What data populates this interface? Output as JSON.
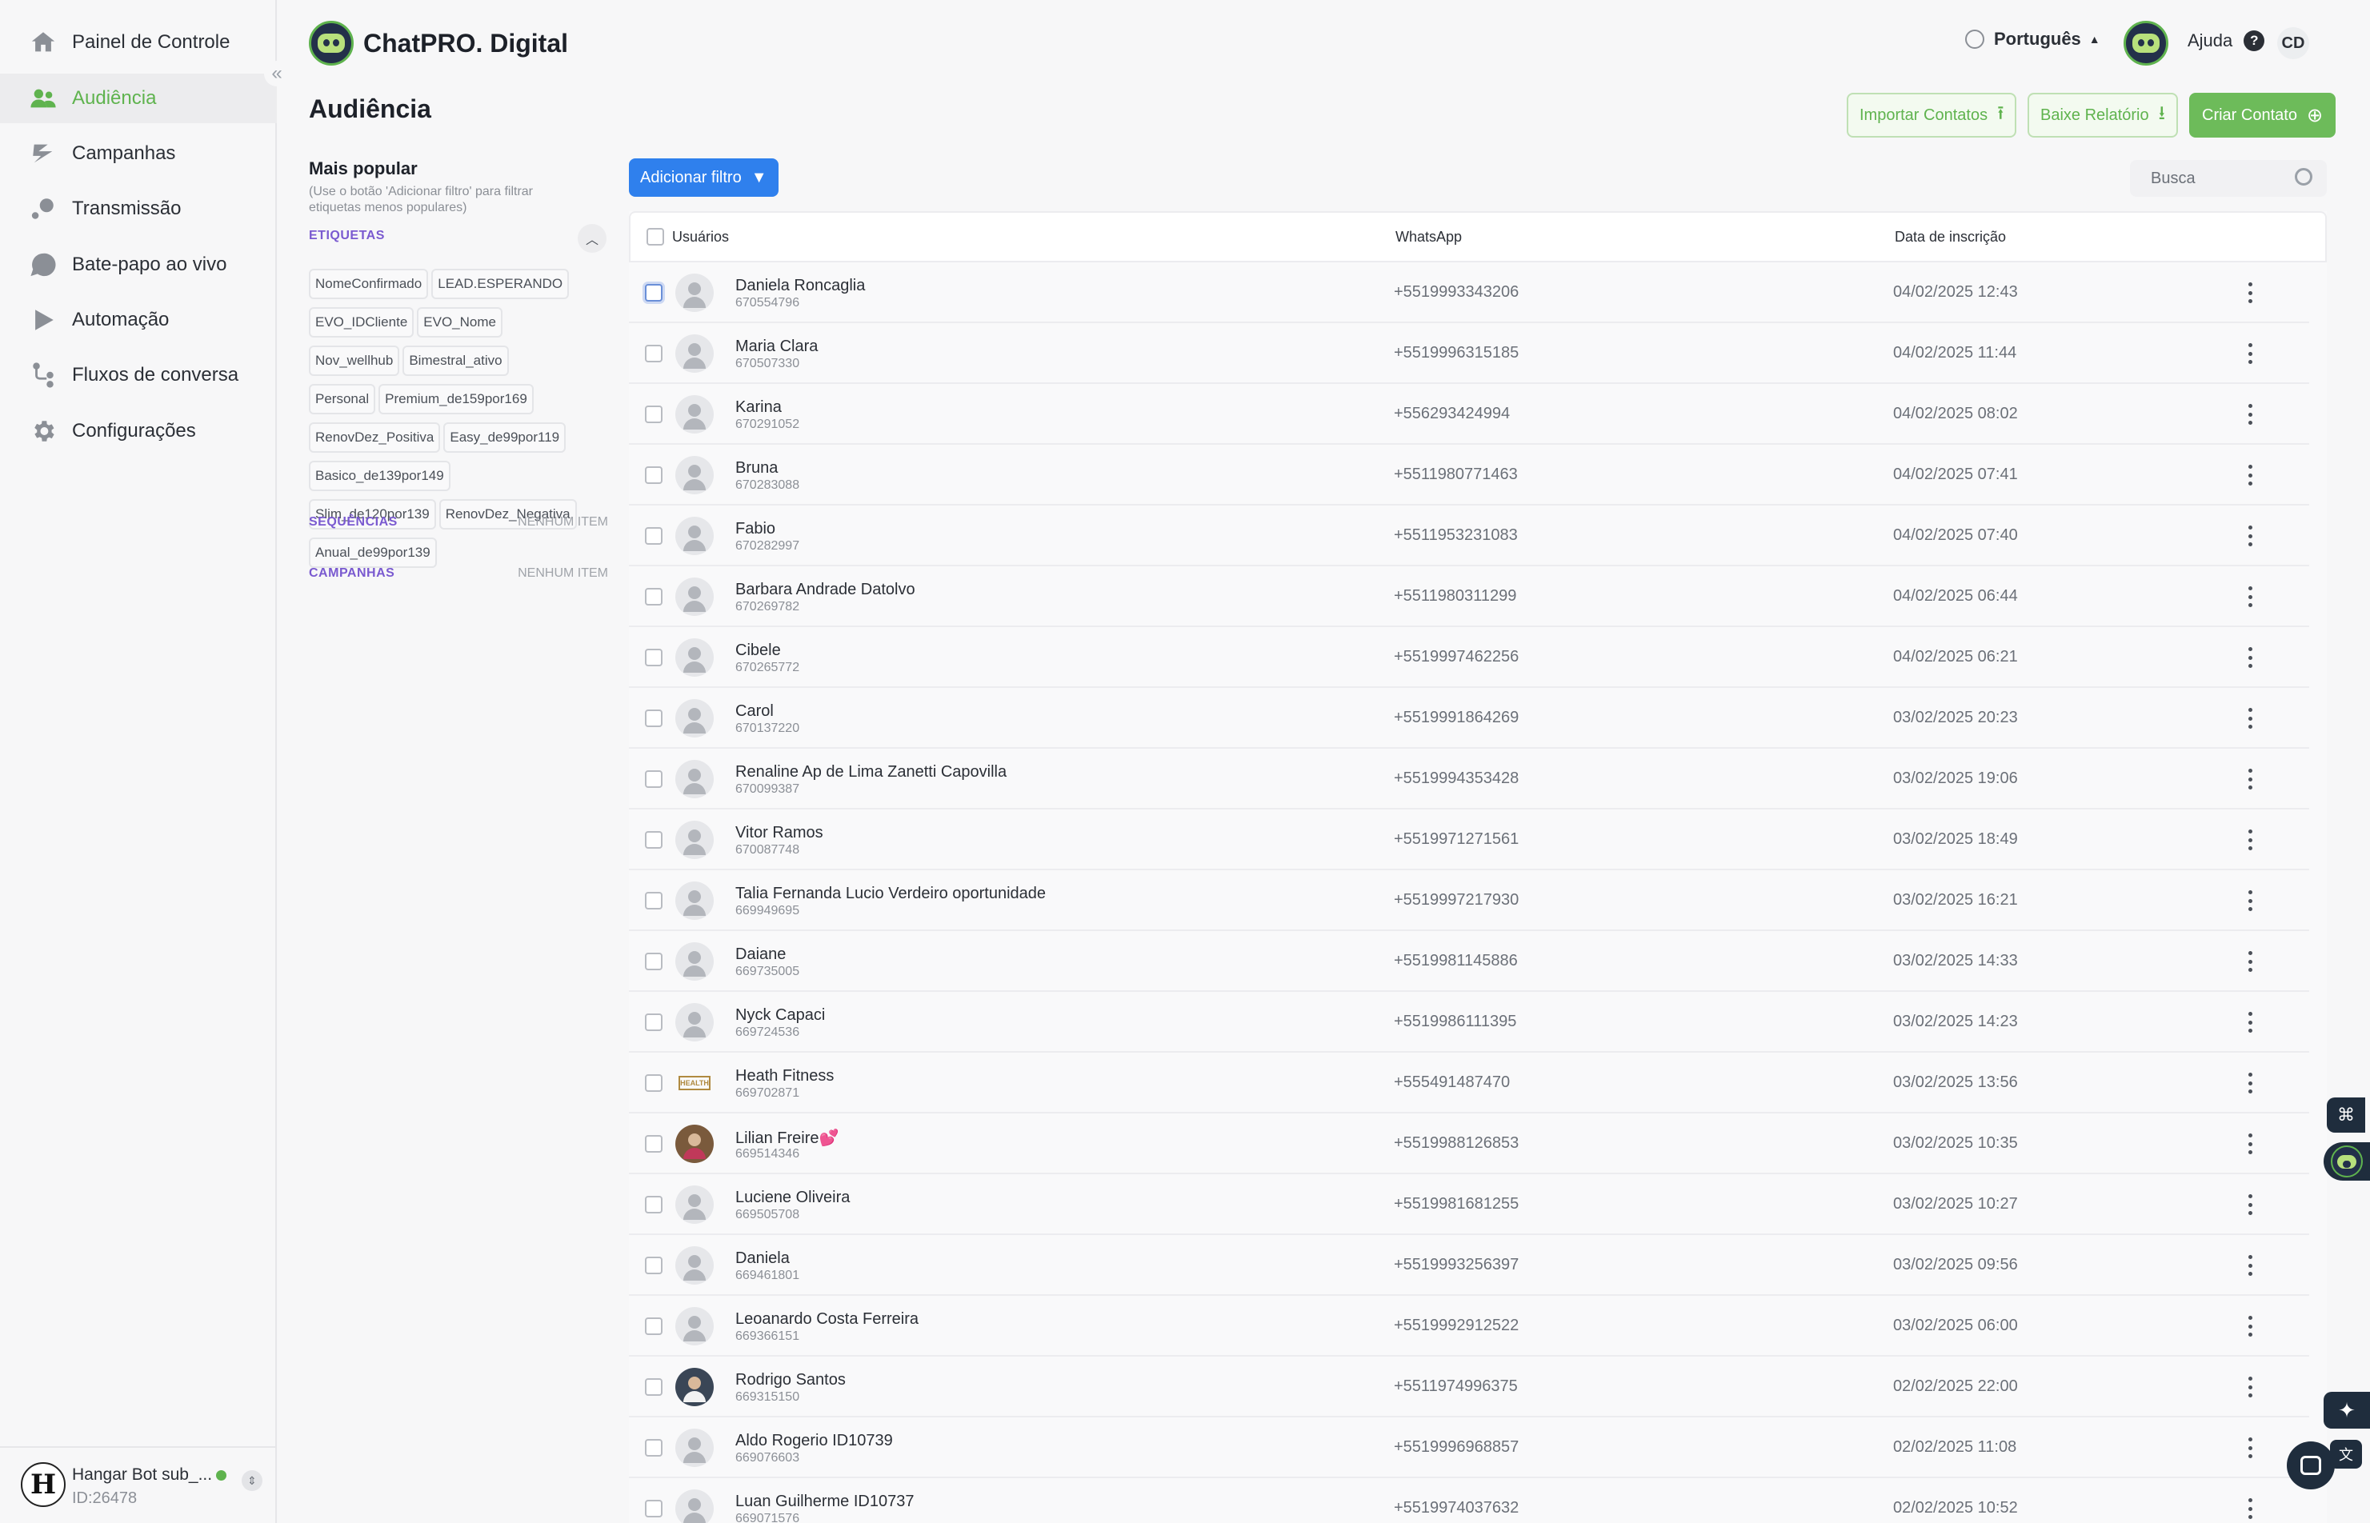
{
  "sidebar": {
    "items": [
      {
        "label": "Painel de Controle",
        "icon": "home-icon"
      },
      {
        "label": "Audiência",
        "icon": "users-icon",
        "active": true
      },
      {
        "label": "Campanhas",
        "icon": "campaign-icon"
      },
      {
        "label": "Transmissão",
        "icon": "broadcast-icon"
      },
      {
        "label": "Bate-papo ao vivo",
        "icon": "chat-icon"
      },
      {
        "label": "Automação",
        "icon": "automation-icon"
      },
      {
        "label": "Fluxos de conversa",
        "icon": "flow-icon"
      },
      {
        "label": "Configurações",
        "icon": "gear-icon"
      }
    ],
    "collapse_glyph": "«",
    "account": {
      "logo_letter": "H",
      "name": "Hangar Bot sub_...",
      "id": "ID:26478"
    }
  },
  "header": {
    "brand": "ChatPRO. Digital",
    "language": "Português",
    "help": "Ajuda",
    "help_glyph": "?",
    "user_initials": "CD"
  },
  "page": {
    "title": "Audiência",
    "buttons": {
      "import": "Importar Contatos",
      "report": "Baixe Relatório",
      "create": "Criar Contato"
    }
  },
  "filters": {
    "title": "Mais popular",
    "hint": "(Use o botão 'Adicionar filtro' para filtrar etiquetas menos populares)",
    "tags_label": "ETIQUETAS",
    "tags": [
      "NomeConfirmado",
      "LEAD.ESPERANDO",
      "EVO_IDCliente",
      "EVO_Nome",
      "Nov_wellhub",
      "Bimestral_ativo",
      "Personal",
      "Premium_de159por169",
      "RenovDez_Positiva",
      "Easy_de99por119",
      "Basico_de139por149",
      "Slim_de120por139",
      "RenovDez_Negativa",
      "Anual_de99por139"
    ],
    "sequences_label": "SEQUÊNCIAS",
    "sequences_empty": "NENHUM ITEM",
    "campaigns_label": "CAMPANHAS",
    "campaigns_empty": "NENHUM ITEM"
  },
  "toolbar": {
    "add_filter": "Adicionar filtro",
    "search_placeholder": "Busca"
  },
  "table": {
    "headers": {
      "users": "Usuários",
      "whatsapp": "WhatsApp",
      "date": "Data de inscrição"
    },
    "rows": [
      {
        "name": "Daniela Roncaglia",
        "id": "670554796",
        "phone": "+5519993343206",
        "date": "04/02/2025 12:43",
        "avatar": "default"
      },
      {
        "name": "Maria Clara",
        "id": "670507330",
        "phone": "+5519996315185",
        "date": "04/02/2025 11:44",
        "avatar": "default"
      },
      {
        "name": "Karina",
        "id": "670291052",
        "phone": "+556293424994",
        "date": "04/02/2025 08:02",
        "avatar": "default"
      },
      {
        "name": "Bruna",
        "id": "670283088",
        "phone": "+5511980771463",
        "date": "04/02/2025 07:41",
        "avatar": "default"
      },
      {
        "name": "Fabio",
        "id": "670282997",
        "phone": "+5511953231083",
        "date": "04/02/2025 07:40",
        "avatar": "default"
      },
      {
        "name": "Barbara Andrade Datolvo",
        "id": "670269782",
        "phone": "+5511980311299",
        "date": "04/02/2025 06:44",
        "avatar": "default"
      },
      {
        "name": "Cibele",
        "id": "670265772",
        "phone": "+5519997462256",
        "date": "04/02/2025 06:21",
        "avatar": "default"
      },
      {
        "name": "Carol",
        "id": "670137220",
        "phone": "+5519991864269",
        "date": "03/02/2025 20:23",
        "avatar": "default"
      },
      {
        "name": "Renaline Ap de Lima Zanetti Capovilla",
        "id": "670099387",
        "phone": "+5519994353428",
        "date": "03/02/2025 19:06",
        "avatar": "default"
      },
      {
        "name": "Vitor Ramos",
        "id": "670087748",
        "phone": "+5519971271561",
        "date": "03/02/2025 18:49",
        "avatar": "default"
      },
      {
        "name": "Talia Fernanda Lucio Verdeiro oportunidade",
        "id": "669949695",
        "phone": "+5519997217930",
        "date": "03/02/2025 16:21",
        "avatar": "default"
      },
      {
        "name": "Daiane",
        "id": "669735005",
        "phone": "+5519981145886",
        "date": "03/02/2025 14:33",
        "avatar": "default"
      },
      {
        "name": "Nyck Capaci",
        "id": "669724536",
        "phone": "+5519986111395",
        "date": "03/02/2025 14:23",
        "avatar": "default"
      },
      {
        "name": "Heath Fitness",
        "id": "669702871",
        "phone": "+555491487470",
        "date": "03/02/2025 13:56",
        "avatar": "logo",
        "logo_text": "HEALTH"
      },
      {
        "name": "Lilian Freire💕",
        "id": "669514346",
        "phone": "+5519988126853",
        "date": "03/02/2025 10:35",
        "avatar": "photo"
      },
      {
        "name": "Luciene Oliveira",
        "id": "669505708",
        "phone": "+5519981681255",
        "date": "03/02/2025 10:27",
        "avatar": "default"
      },
      {
        "name": "Daniela",
        "id": "669461801",
        "phone": "+5519993256397",
        "date": "03/02/2025 09:56",
        "avatar": "default"
      },
      {
        "name": "Leoanardo Costa Ferreira",
        "id": "669366151",
        "phone": "+5519992912522",
        "date": "03/02/2025 06:00",
        "avatar": "default"
      },
      {
        "name": "Rodrigo Santos",
        "id": "669315150",
        "phone": "+5511974996375",
        "date": "02/02/2025 22:00",
        "avatar": "photo2"
      },
      {
        "name": "Aldo Rogerio ID10739",
        "id": "669076603",
        "phone": "+5519996968857",
        "date": "02/02/2025 11:08",
        "avatar": "default"
      },
      {
        "name": "Luan Guilherme ID10737",
        "id": "669071576",
        "phone": "+5519974037632",
        "date": "02/02/2025 10:52",
        "avatar": "default"
      }
    ]
  },
  "floating": {
    "apps_glyph": "⌘",
    "ai_glyph": "✦",
    "translate_glyph": "文"
  },
  "colors": {
    "accent": "#5fb34e",
    "primary_blue": "#2f80ed",
    "section_purple": "#7a5ad0"
  }
}
